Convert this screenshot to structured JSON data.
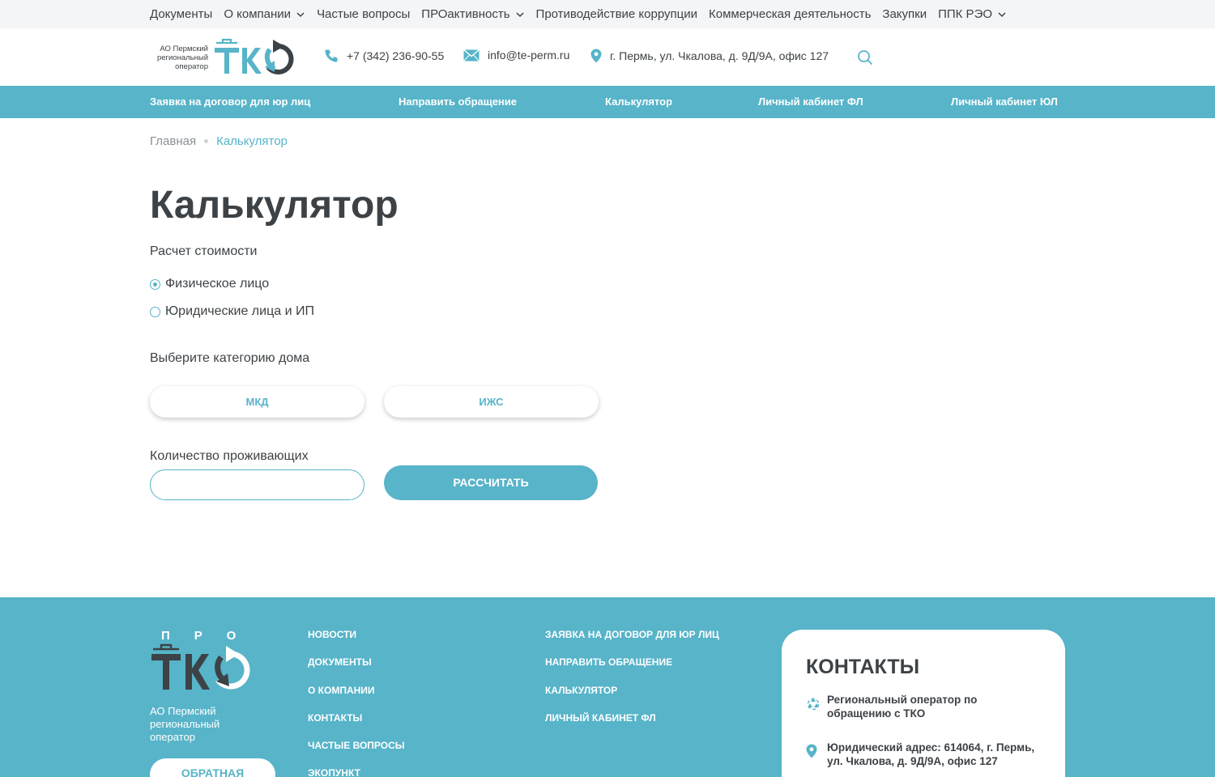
{
  "top_nav": [
    {
      "label": "Документы",
      "has_dropdown": false
    },
    {
      "label": "О компании",
      "has_dropdown": true
    },
    {
      "label": "Частые вопросы",
      "has_dropdown": false
    },
    {
      "label": "ПРОактивность",
      "has_dropdown": true
    },
    {
      "label": "Противодействие коррупции",
      "has_dropdown": false
    },
    {
      "label": "Коммерческая деятельность",
      "has_dropdown": false
    },
    {
      "label": "Закупки",
      "has_dropdown": false
    },
    {
      "label": "ППК РЭО",
      "has_dropdown": true
    }
  ],
  "header": {
    "logo_caption": "АО Пермский региональный оператор",
    "logo_mark": "ТКО",
    "phone": "+7 (342) 236-90-55",
    "email": "info@te-perm.ru",
    "address": "г. Пермь, ул. Чкалова, д. 9Д/9А, офис 127"
  },
  "main_menu": [
    "Заявка на договор для юр лиц",
    "Направить обращение",
    "Калькулятор",
    "Личный кабинет ФЛ",
    "Личный кабинет ЮЛ"
  ],
  "breadcrumb": {
    "home": "Главная",
    "current": "Калькулятор"
  },
  "page_title": "Калькулятор",
  "calculator": {
    "cost_label": "Расчет стоимости",
    "person_types": [
      {
        "label": "Физическое лицо",
        "checked": true
      },
      {
        "label": "Юридические лица и ИП",
        "checked": false
      }
    ],
    "house_category_label": "Выберите категорию дома",
    "house_categories": [
      "МКД",
      "ИЖС"
    ],
    "residents_label": "Количество проживающих",
    "residents_value": "",
    "calculate_label": "РАССЧИТАТЬ"
  },
  "footer": {
    "logo_top": "ПРО",
    "logo_mark": "ТКО",
    "org": "АО Пермский региональный оператор",
    "feedback_label": "ОБРАТНАЯ",
    "col1": [
      "НОВОСТИ",
      "ДОКУМЕНТЫ",
      "О КОМПАНИИ",
      "КОНТАКТЫ",
      "ЧАСТЫЕ ВОПРОСЫ",
      "ЭКОПУНКТ"
    ],
    "col2": [
      "ЗАЯВКА НА ДОГОВОР ДЛЯ ЮР ЛИЦ",
      "НАПРАВИТЬ ОБРАЩЕНИЕ",
      "КАЛЬКУЛЯТОР",
      "ЛИЧНЫЙ КАБИНЕТ ФЛ"
    ],
    "contacts": {
      "title": "КОНТАКТЫ",
      "operator": "Региональный оператор по обращению с ТКО",
      "legal_address": "Юридический адрес: 614064, г. Пермь, ул. Чкалова, д. 9Д/9А, офис 127"
    }
  },
  "colors": {
    "accent": "#57b4c9",
    "text": "#3d4246",
    "topbar_bg": "#f4f5f6"
  }
}
